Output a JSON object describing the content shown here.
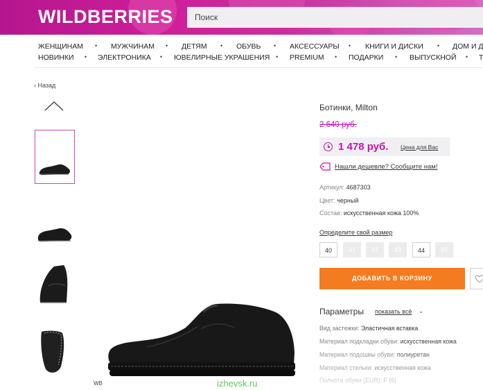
{
  "header": {
    "logo": "WILDBERRIES",
    "search_placeholder": "Поиск"
  },
  "nav": {
    "row1": [
      "ЖЕНЩИНАМ",
      "МУЖЧИНАМ",
      "ДЕТЯМ",
      "ОБУВЬ",
      "АКСЕССУАРЫ",
      "КНИГИ И ДИСКИ",
      "ДОМ И Д"
    ],
    "row2": [
      "НОВИНКИ",
      "ЭЛЕКТРОНИКА",
      "ЮВЕЛИРНЫЕ УКРАШЕНИЯ",
      "PREMIUM",
      "ПОДАРКИ",
      "ВЫПУСКНОЙ",
      "Т"
    ]
  },
  "back_label": "Назад",
  "gallery": {
    "brand_mark": "WB"
  },
  "watermark": "izhevsk.ru",
  "product": {
    "title": "Ботинки, Milton",
    "old_price": "2 640 руб.",
    "price": "1 478 руб.",
    "price_note": "Цена для Вас",
    "cheaper_link": "Нашли дешевле? Сообщите нам!",
    "specs": [
      {
        "key": "Артикул:",
        "value": "4687303"
      },
      {
        "key": "Цвет:",
        "value": "черный"
      },
      {
        "key": "Состав:",
        "value": "искусственная кожа 100%"
      }
    ],
    "size_link": "Определите свой размер",
    "sizes": [
      {
        "label": "40",
        "available": true
      },
      {
        "label": "41",
        "available": false
      },
      {
        "label": "42",
        "available": false
      },
      {
        "label": "43",
        "available": false
      },
      {
        "label": "44",
        "available": true
      },
      {
        "label": "45",
        "available": false
      }
    ],
    "add_to_cart": "ДОБАВИТЬ В КОРЗИНУ",
    "params_title": "Параметры",
    "show_all": "показать всё",
    "params": [
      {
        "key": "Вид застежки:",
        "value": "Эластичная вставка"
      },
      {
        "key": "Материал подкладки обуви:",
        "value": "искусственная кожа"
      },
      {
        "key": "Материал подошвы обуви:",
        "value": "полиуретан"
      },
      {
        "key": "Материал стельки:",
        "value": "искусственная кожа"
      },
      {
        "key": "Полнота обуви (EUR):",
        "value": "F (6)"
      }
    ]
  },
  "colors": {
    "brand": "#cb11ab",
    "cart_button": "#f47b20"
  }
}
